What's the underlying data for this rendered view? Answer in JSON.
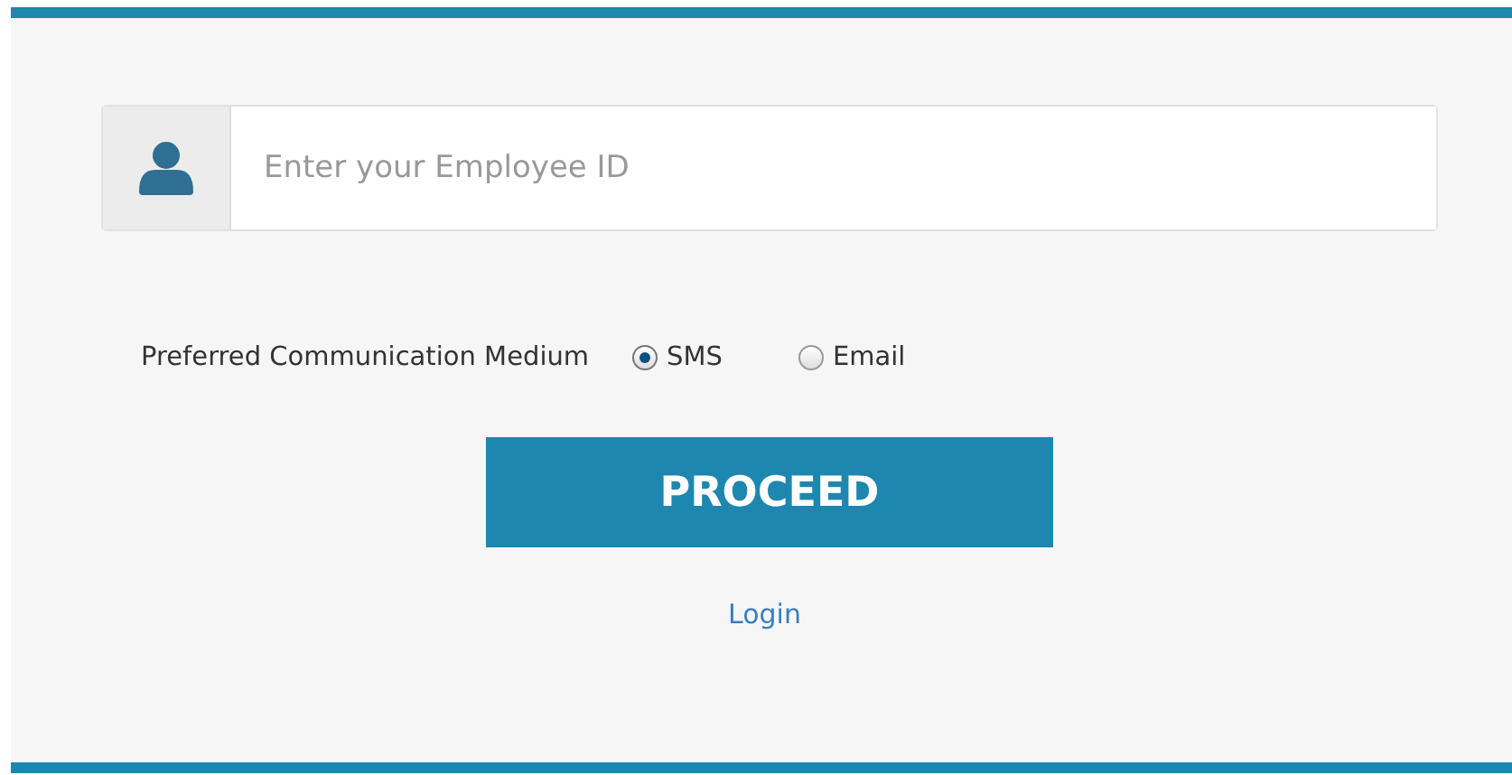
{
  "employee_id": {
    "placeholder": "Enter your Employee ID"
  },
  "communication": {
    "label": "Preferred Communication Medium",
    "options": [
      {
        "label": "SMS",
        "selected": true
      },
      {
        "label": "Email",
        "selected": false
      }
    ]
  },
  "proceed_button": "PROCEED",
  "login_link": "Login"
}
